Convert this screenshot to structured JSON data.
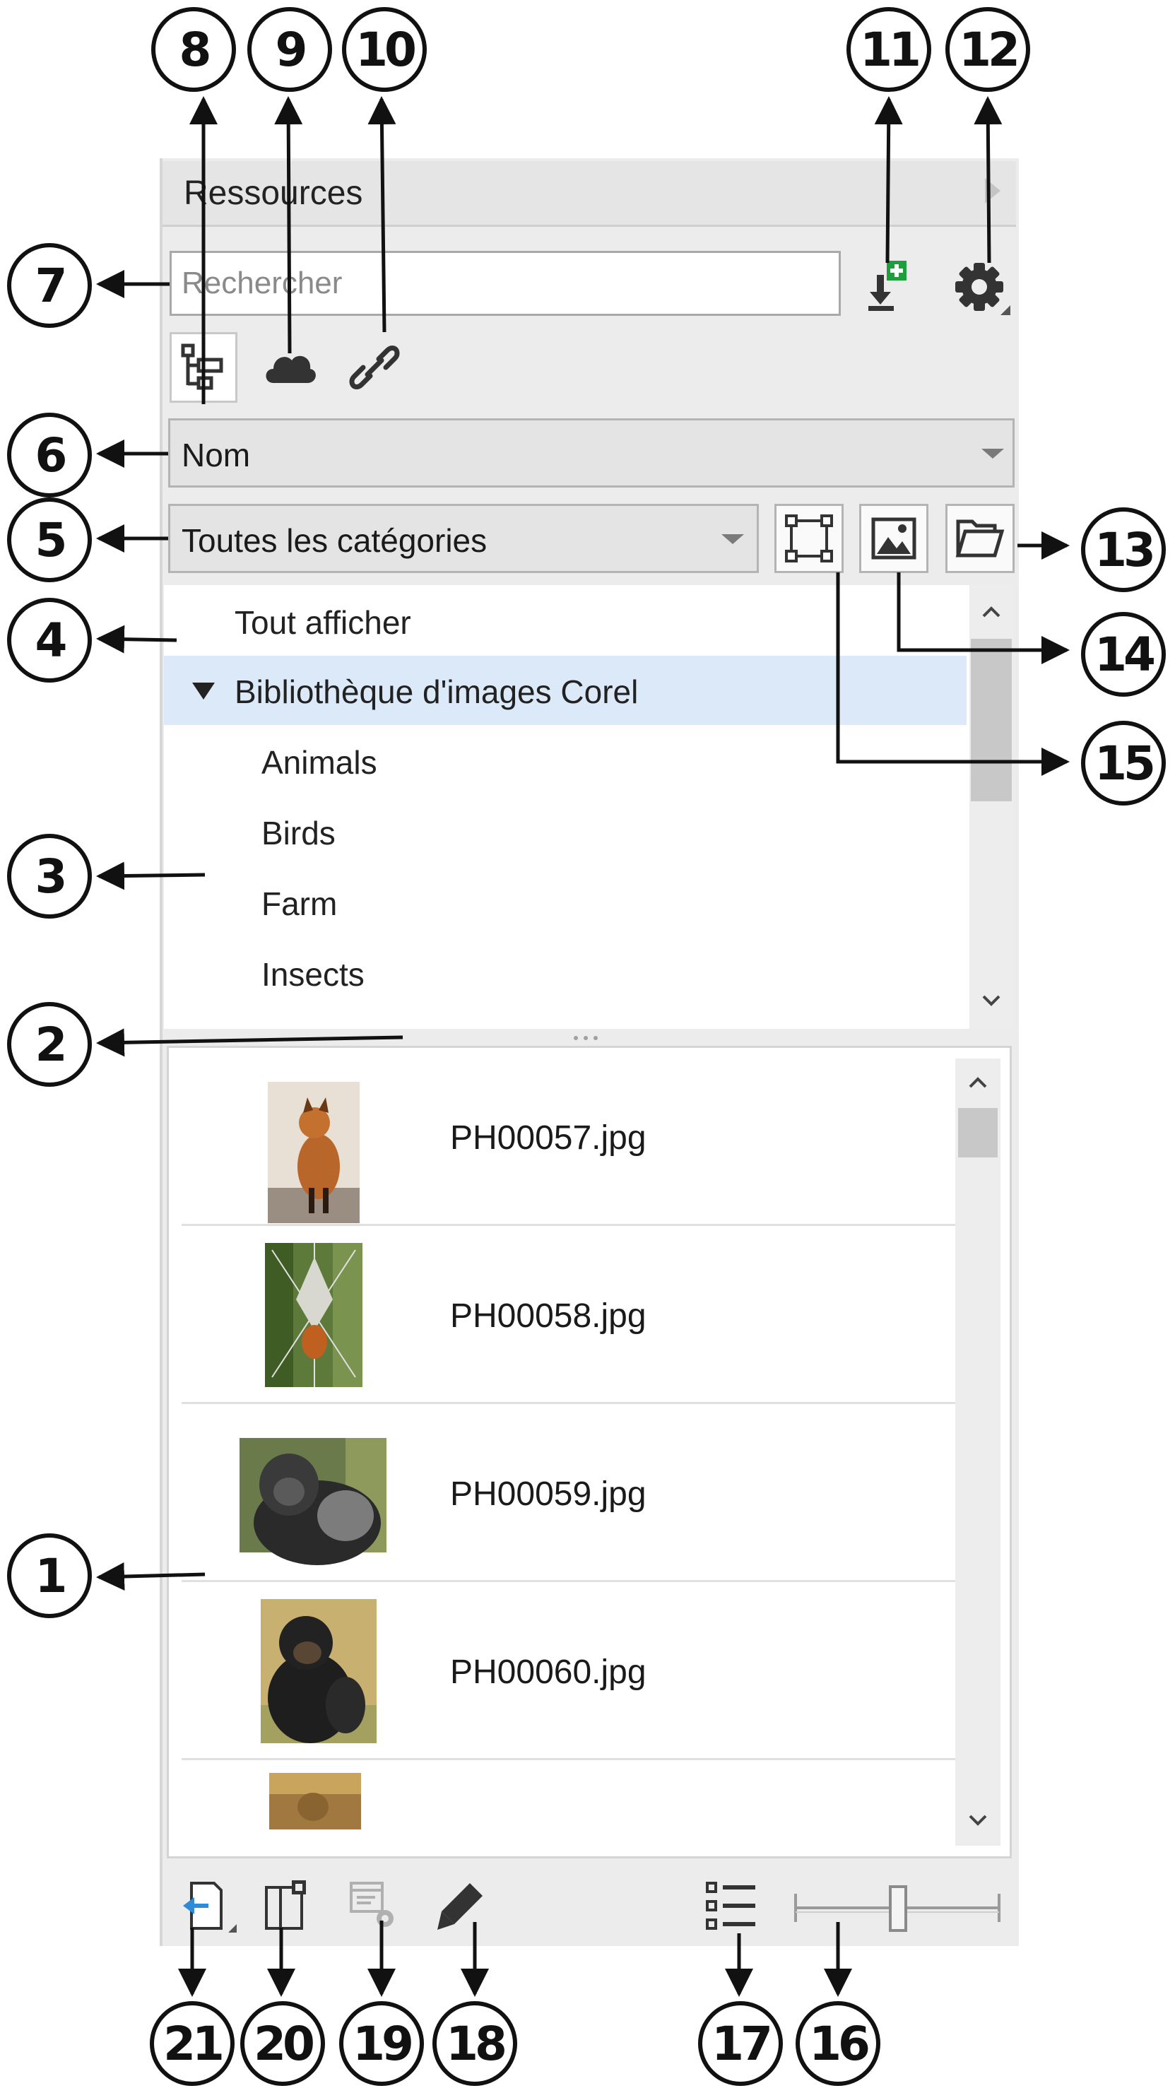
{
  "panel": {
    "title": "Ressources"
  },
  "search": {
    "placeholder": "Rechercher"
  },
  "sort_dropdown": {
    "value": "Nom"
  },
  "category_dropdown": {
    "value": "Toutes les catégories"
  },
  "tree": {
    "items": [
      {
        "label": "Tout afficher"
      },
      {
        "label": "Bibliothèque d'images Corel",
        "expanded": true,
        "selected": true
      },
      {
        "label": "Animals"
      },
      {
        "label": "Birds"
      },
      {
        "label": "Farm"
      },
      {
        "label": "Insects"
      }
    ]
  },
  "results": [
    {
      "filename": "PH00057.jpg"
    },
    {
      "filename": "PH00058.jpg"
    },
    {
      "filename": "PH00059.jpg"
    },
    {
      "filename": "PH00060.jpg"
    }
  ],
  "callouts": [
    "1",
    "2",
    "3",
    "4",
    "5",
    "6",
    "7",
    "8",
    "9",
    "10",
    "11",
    "12",
    "13",
    "14",
    "15",
    "16",
    "17",
    "18",
    "19",
    "20",
    "21"
  ],
  "colors": {
    "accent_green": "#1e9e3c",
    "selection_blue": "#dbe9f8",
    "link_blue": "#2f8ad8"
  },
  "icons": {
    "title_bar": "expand-arrow-icon",
    "import": "import-icon",
    "settings": "gear-icon",
    "sources": [
      "folder-tree-icon",
      "cloud-icon",
      "link-icon"
    ],
    "view_filters": [
      "vector-icon",
      "image-icon",
      "folder-icon"
    ],
    "bottom": [
      "import-to-document-icon",
      "open-document-icon",
      "properties-icon",
      "edit-icon",
      "list-view-icon",
      "thumbnail-size-slider"
    ]
  }
}
